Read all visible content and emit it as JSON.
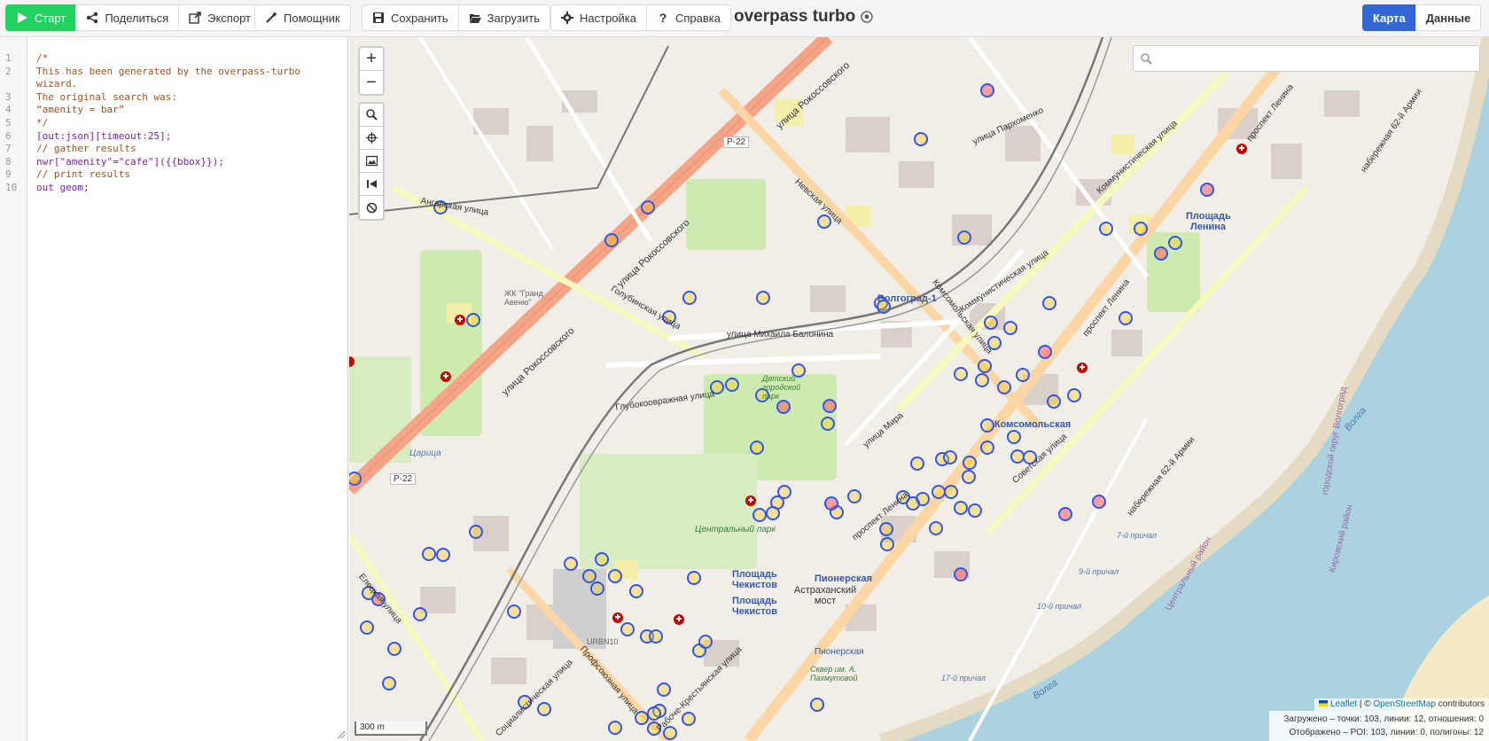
{
  "toolbar": {
    "start": "Старт",
    "share": "Поделиться",
    "export": "Экспорт",
    "wizard": "Помощник",
    "save": "Сохранить",
    "load": "Загрузить",
    "settings": "Настройка",
    "help": "Справка",
    "brand": "overpass turbo",
    "tab_map": "Карта",
    "tab_data": "Данные"
  },
  "editor": {
    "line_numbers": [
      "1",
      "2",
      "3",
      "4",
      "5",
      "6",
      "7",
      "8",
      "9",
      "10"
    ],
    "lines": [
      "/*",
      "This has been generated by the overpass-turbo wizard.",
      "The original search was:",
      "“amenity = bar”",
      "*/",
      "[out:json][timeout:25];",
      "// gather results",
      "nwr[\"amenity\"=\"cafe\"]({{bbox}});",
      "// print results",
      "out geom;"
    ]
  },
  "map": {
    "search_placeholder": "",
    "scale": "300 m",
    "attribution_leaflet": "Leaflet",
    "attribution_osm": "OpenStreetMap",
    "attribution_tail": "contributors",
    "stats_loaded": "Загружено – точки: 103, линии: 12, отношения: 0",
    "stats_shown": "Отображено – POI: 103, линии: 0, полигоны: 12",
    "labels": {
      "ulitsa_rokossovskogo_top": "улица Рокоссовского",
      "ulitsa_rokossovskogo_mid": "улица Рокоссовского",
      "ulitsa_rokossovskogo_low": "улица Рокоссовского",
      "r22_top": "Р-22",
      "r22_low": "Р-22",
      "nevskaya": "Невская улица",
      "kommunisticheskaya_top": "Коммунистическая улица",
      "kommunisticheskaya_mid": "Коммунистическая улица",
      "prospekt_lenina_top": "проспект Ленина",
      "prospekt_lenina_mid": "проспект Ленина",
      "prospekt_lenina_low": "проспект Ленина",
      "ploshchad_lenina": "Площадь Ленина",
      "volgograd1": "Волгоград-1",
      "ulitsa_balonina": "улица Михаила Балонина",
      "komsomolskaya": "Комсомольская",
      "komsomolskaya_ulitsa": "Комсомольская улица",
      "glubokoovrazhnaya": "Глубокоовражная улица",
      "golubinskaya": "Голубинская улица",
      "ansgarskaya": "Ангарская улица",
      "zhk_grand": "ЖК \"Гранд Авеню\"",
      "tsaritsa": "Царица",
      "tsentralny_park": "Центральный парк",
      "ploshchad_chekistov_1": "Площадь Чекистов",
      "ploshchad_chekistov_2": "Площадь Чекистов",
      "pionerskaya": "Пионерская",
      "astrakhansky_most": "Астраханский мост",
      "pionerskaya_2": "Пионерская",
      "skver": "Сквер им. А. Пахмутовой",
      "urbn10": "URBN10",
      "prichal_7": "7-й причал",
      "prichal_9": "9-й причал",
      "prichal_10": "10-й причал",
      "prichal_17": "17-й причал",
      "volga_1": "Волга",
      "volga_2": "Волга",
      "naberezhnaya_62": "набережная 62-й Армии",
      "naberezhnaya_62_b": "набережная 62-й Армии",
      "sovetskaya": "Советская улица",
      "ulitsa_mira": "улица Мира",
      "ulitsa_parkhomenko": "улица Пархоменко",
      "elecskaya": "Елецкая улица",
      "rabochekrest": "Рабоче-Крестьянская улица",
      "profsoyuznaya": "Профсоюзная улица",
      "sotsialisticheskaya": "Социалистическая улица",
      "kirovsky": "Кировский район",
      "tsentralny_rayon": "Центральный район",
      "gorodskoy_okrug": "городской округ Волгоград",
      "detsky_park": "Детский городской парк"
    }
  }
}
